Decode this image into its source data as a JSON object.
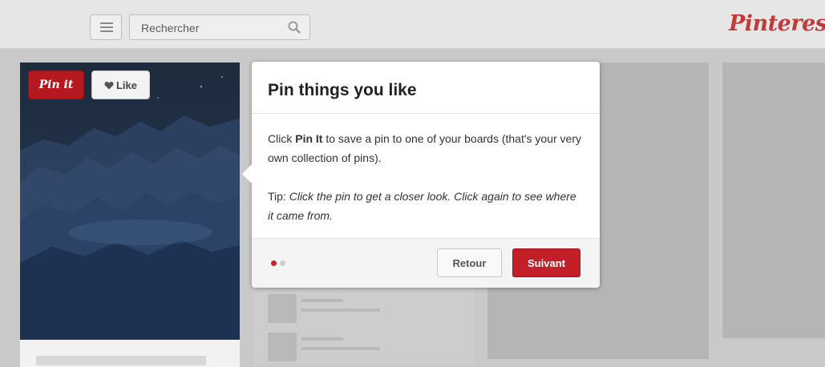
{
  "header": {
    "search_placeholder": "Rechercher",
    "logo_text": "Pinterest",
    "brand_color": "#c23a3a"
  },
  "pin": {
    "pin_it_label": "Pin it",
    "like_label": "Like"
  },
  "tutorial": {
    "title": "Pin things you like",
    "body_before": "Click ",
    "body_strong": "Pin It",
    "body_after": " to save a pin to one of your boards (that's your very own collection of pins).",
    "tip_label": "Tip: ",
    "tip_text": "Click the pin to get a closer look. Click again to see where it came from.",
    "back_label": "Retour",
    "next_label": "Suivant",
    "step_dots": 2,
    "active_step": 1,
    "accent_color": "#c21f28"
  },
  "icons": {
    "menu": "hamburger-icon",
    "search": "magnifier-icon",
    "like": "heart-icon"
  }
}
